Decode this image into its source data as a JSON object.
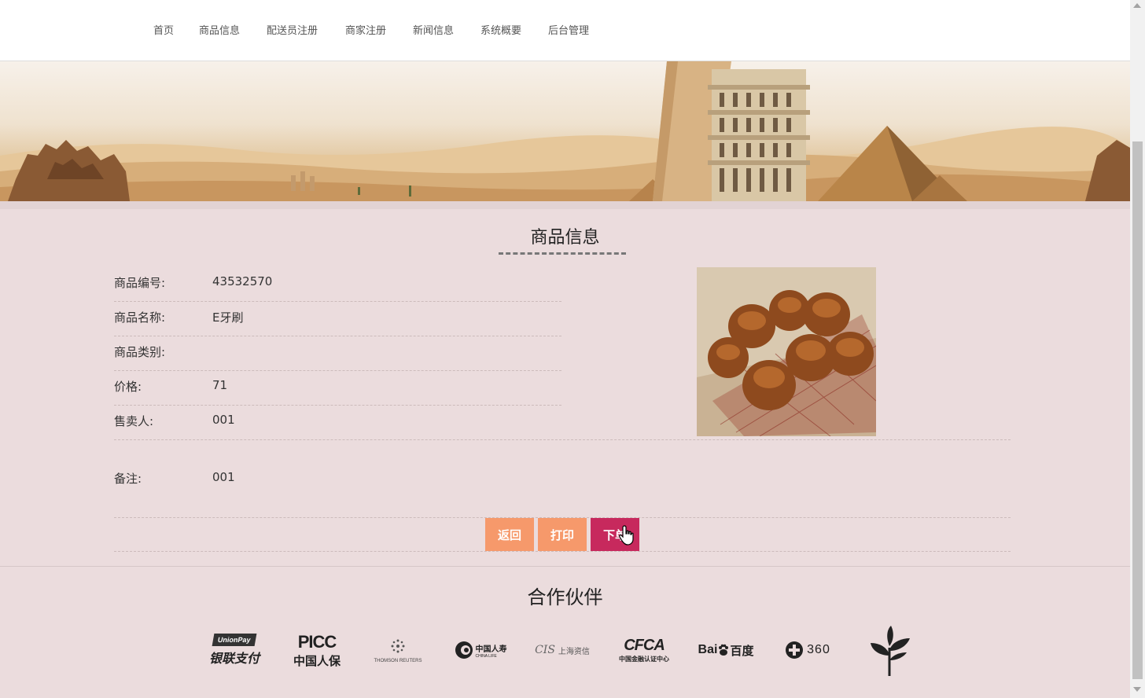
{
  "nav": {
    "items": [
      "首页",
      "商品信息",
      "配送员注册",
      "商家注册",
      "新闻信息",
      "系统概要",
      "后台管理"
    ]
  },
  "banner": {
    "slide_count": 5,
    "active_slide": 1
  },
  "product": {
    "section_title": "商品信息",
    "fields": [
      {
        "label": "商品编号:",
        "value": "43532570"
      },
      {
        "label": "商品名称:",
        "value": "E牙刷"
      },
      {
        "label": "商品类别:",
        "value": ""
      },
      {
        "label": "价格:",
        "value": "71"
      },
      {
        "label": "售卖人:",
        "value": "001"
      }
    ],
    "note": {
      "label": "备注:",
      "value": "001"
    }
  },
  "actions": {
    "back_label": "返回",
    "print_label": "打印",
    "order_label": "下单"
  },
  "partners": {
    "title": "合作伙伴",
    "logos": [
      {
        "name": "unionpay-logo",
        "text": "银联支付",
        "sub": "UnionPay"
      },
      {
        "name": "picc-logo",
        "text": "中国人保",
        "sub": "PICC"
      },
      {
        "name": "thomson-reuters-logo",
        "text": "",
        "sub": "THOMSON REUTERS"
      },
      {
        "name": "china-life-logo",
        "text": "中国人寿",
        "sub": "CHINA LIFE"
      },
      {
        "name": "cis-logo",
        "text": "上海资信",
        "sub": "CIS"
      },
      {
        "name": "cfca-logo",
        "text": "中国金融认证中心",
        "sub": "CFCA"
      },
      {
        "name": "baidu-logo",
        "text": "百度",
        "sub": "Bai"
      },
      {
        "name": "360-logo",
        "text": "",
        "sub": "360"
      },
      {
        "name": "tree-logo",
        "text": "",
        "sub": ""
      }
    ]
  },
  "colors": {
    "page_bg": "#ebdcdd",
    "button_orange": "#f6996b",
    "button_order": "#c7295d"
  }
}
